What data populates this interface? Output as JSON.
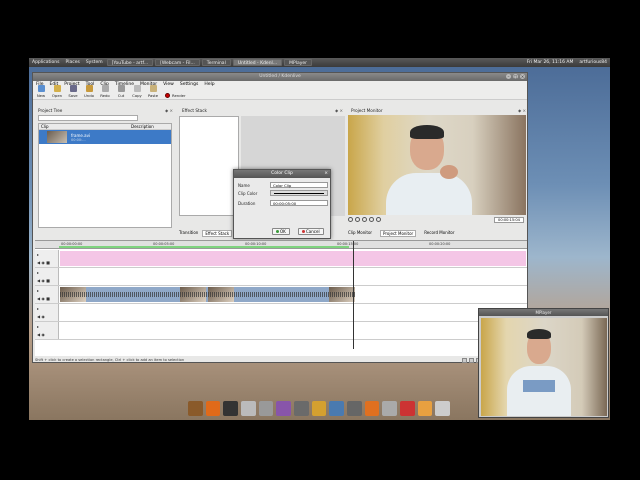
{
  "topbar": {
    "menus": [
      "Applications",
      "Places",
      "System"
    ],
    "tasks": [
      "[YouTube - artf...",
      "[Webcam - Fil...",
      "Terminal",
      "Untitled - Kdenl...",
      "MPlayer"
    ],
    "active_task_index": 3,
    "clock": "Fri Mar 26, 11:16 AM",
    "user": "artfurious84"
  },
  "window": {
    "title": "Untitled / Kdenlive"
  },
  "menubar": [
    "File",
    "Edit",
    "Project",
    "Tool",
    "Clip",
    "Timeline",
    "Monitor",
    "View",
    "Settings",
    "Help"
  ],
  "toolbar": [
    {
      "label": "New",
      "color": "#5a8fd0"
    },
    {
      "label": "Open",
      "color": "#d4b04a"
    },
    {
      "label": "Save",
      "color": "#6a6a8a"
    },
    {
      "label": "Undo",
      "color": "#c89a3c"
    },
    {
      "label": "Redo",
      "color": "#aaaaaa"
    },
    {
      "label": "Cut",
      "color": "#999999"
    },
    {
      "label": "Copy",
      "color": "#bbbbbb"
    },
    {
      "label": "Paste",
      "color": "#c9b27a"
    }
  ],
  "record_label": "Render",
  "project_tree": {
    "title": "Project Tree",
    "col_clip": "Clip",
    "col_description": "Description",
    "item_name": "frame.avi",
    "item_sub": "00:00:..."
  },
  "effect_stack": {
    "title": "Effect Stack",
    "tabs": [
      "Transition",
      "Effect Stack",
      "Effect List"
    ],
    "selected_tab": 1
  },
  "project_monitor": {
    "title": "Project Monitor",
    "timecode": "00:00:15:04",
    "tabs": [
      "Clip Monitor",
      "Project Monitor",
      "Record Monitor"
    ],
    "selected_tab": 1
  },
  "timeline": {
    "ticks": [
      "00:00:00:00",
      "00:00:05:00",
      "00:00:10:00",
      "00:00:15:00",
      "00:00:20:00"
    ],
    "cursor_position": "00:00:15:00"
  },
  "status": "Shift + click to create a selection rectangle, Ctrl + click to add an item to selection",
  "dialog": {
    "title": "Color Clip",
    "name_label": "Name",
    "name_value": "Color Clip",
    "color_label": "Clip Color",
    "duration_label": "Duration",
    "duration_value": "00:00:05:00",
    "ok_label": "OK",
    "cancel_label": "Cancel"
  },
  "mplayer": {
    "title": "MPlayer"
  },
  "dock_colors": [
    "#8a5a2a",
    "#e06a1a",
    "#333333",
    "#bbbbbb",
    "#999999",
    "#8855aa",
    "#6a6a6a",
    "#d4a030",
    "#4a7ab0",
    "#666666",
    "#e07020",
    "#aaaaaa",
    "#cc3333",
    "#e8a040",
    "#cccccc"
  ]
}
